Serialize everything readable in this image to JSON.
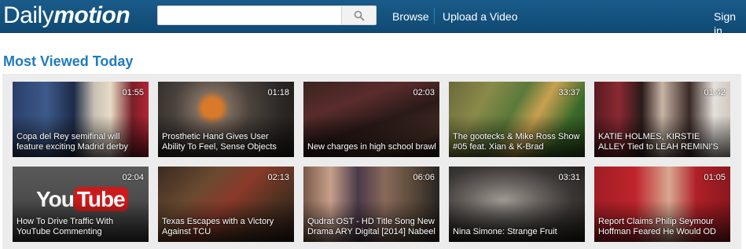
{
  "header": {
    "logo_light": "Daily",
    "logo_bold": "motion",
    "search_placeholder": "",
    "search_icon": "magnifier-icon",
    "nav": {
      "browse": "Browse",
      "upload": "Upload a Video"
    },
    "sign_in": "Sign in",
    "colors": {
      "bar": "#135583",
      "accent": "#1f7bbf"
    }
  },
  "section": {
    "title": "Most Viewed Today"
  },
  "videos": [
    {
      "duration": "01:55",
      "title": "Copa del Rey semifinal will feature exciting Madrid derby"
    },
    {
      "duration": "01:18",
      "title": "Prosthetic Hand Gives User Ability To Feel, Sense Objects"
    },
    {
      "duration": "02:03",
      "title": "New charges in high school brawl"
    },
    {
      "duration": "33:37",
      "title": "The gootecks & Mike Ross Show #05 feat. Xian & K-Brad"
    },
    {
      "duration": "01:42",
      "title": "KATIE HOLMES, KIRSTIE ALLEY Tied to LEAH REMINI'S"
    },
    {
      "duration": "02:04",
      "title": "How To Drive Traffic With YouTube Commenting"
    },
    {
      "duration": "02:13",
      "title": "Texas Escapes with a Victory Against TCU"
    },
    {
      "duration": "06:06",
      "title": "Qudrat OST - HD Title Song New Drama ARY Digital [2014] Nabeel"
    },
    {
      "duration": "03:31",
      "title": "Nina Simone: Strange Fruit"
    },
    {
      "duration": "01:05",
      "title": "Report Claims Philip Seymour Hoffman Feared He Would OD"
    }
  ]
}
